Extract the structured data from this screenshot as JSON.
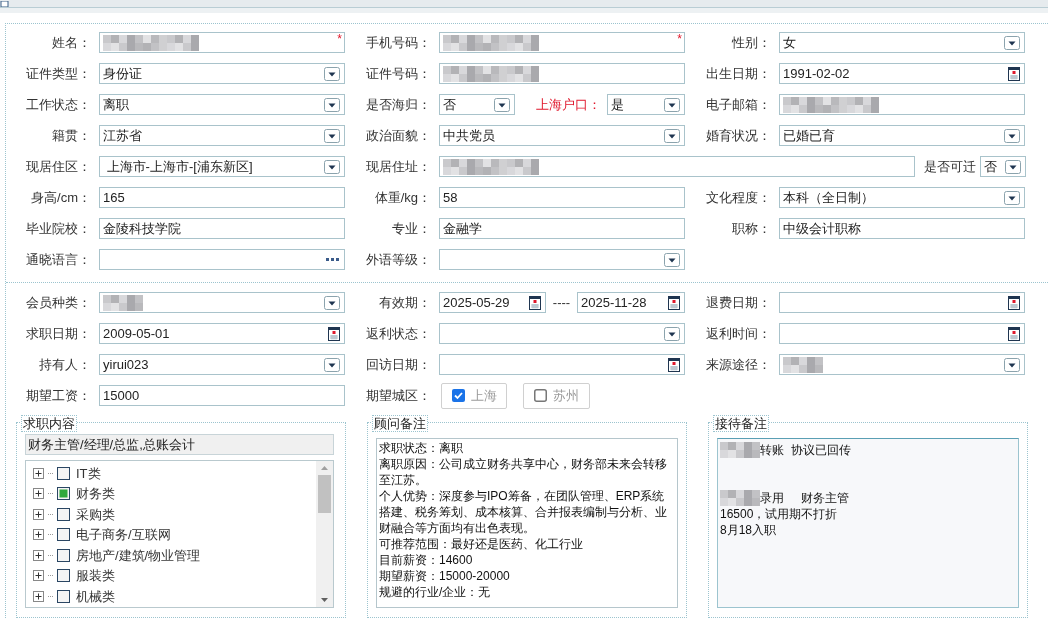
{
  "basic_rows": [
    {
      "cells": [
        {
          "label": "姓名：",
          "fields": [
            {
              "kind": "text",
              "redacted": true,
              "required_mark": "*"
            }
          ]
        },
        {
          "label": "手机号码：",
          "fields": [
            {
              "kind": "text",
              "redacted": true,
              "required_mark": "*"
            }
          ]
        },
        {
          "label": "性别：",
          "fields": [
            {
              "kind": "select",
              "value": "女"
            }
          ]
        }
      ]
    },
    {
      "cells": [
        {
          "label": "证件类型：",
          "fields": [
            {
              "kind": "select",
              "value": "身份证"
            }
          ]
        },
        {
          "label": "证件号码：",
          "fields": [
            {
              "kind": "text",
              "redacted": true
            }
          ]
        },
        {
          "label": "出生日期：",
          "fields": [
            {
              "kind": "date",
              "value": "1991-02-02"
            }
          ]
        }
      ]
    },
    {
      "cells": [
        {
          "label": "工作状态：",
          "fields": [
            {
              "kind": "select",
              "value": "离职"
            }
          ]
        },
        {
          "label": "是否海归：",
          "fields": [
            {
              "kind": "select",
              "value": "否"
            },
            {
              "kind": "select",
              "label": "上海户口：",
              "emphasized": true,
              "value": "是"
            }
          ]
        },
        {
          "label": "电子邮箱：",
          "fields": [
            {
              "kind": "text",
              "redacted": true
            }
          ]
        }
      ]
    },
    {
      "cells": [
        {
          "label": "籍贯：",
          "fields": [
            {
              "kind": "select",
              "value": "江苏省"
            }
          ]
        },
        {
          "label": "政治面貌：",
          "fields": [
            {
              "kind": "select",
              "value": "中共党员"
            }
          ]
        },
        {
          "label": "婚育状况：",
          "fields": [
            {
              "kind": "select",
              "value": "已婚已育"
            }
          ]
        }
      ]
    },
    {
      "cells": [
        {
          "label": "现居住区：",
          "fields": [
            {
              "kind": "select",
              "value": " 上海市-上海市-[浦东新区]"
            }
          ]
        },
        {
          "label": "现居住址：",
          "fields": [
            {
              "kind": "text",
              "redacted": true
            }
          ],
          "trailing": {
            "label": "是否可迁",
            "field": {
              "kind": "select",
              "value": "否"
            }
          }
        }
      ]
    },
    {
      "cells": [
        {
          "label": "身高/cm：",
          "fields": [
            {
              "kind": "text",
              "value": "165"
            }
          ]
        },
        {
          "label": "体重/kg：",
          "fields": [
            {
              "kind": "text",
              "value": "58"
            }
          ]
        },
        {
          "label": "文化程度：",
          "fields": [
            {
              "kind": "select",
              "value": "本科（全日制）"
            }
          ]
        }
      ]
    },
    {
      "cells": [
        {
          "label": "毕业院校：",
          "fields": [
            {
              "kind": "text",
              "value": "金陵科技学院"
            }
          ]
        },
        {
          "label": "专业：",
          "fields": [
            {
              "kind": "text",
              "value": "金融学"
            }
          ]
        },
        {
          "label": "职称：",
          "fields": [
            {
              "kind": "text",
              "value": "中级会计职称"
            }
          ]
        }
      ]
    },
    {
      "cells": [
        {
          "label": "通晓语言：",
          "fields": [
            {
              "kind": "lookup"
            }
          ]
        },
        {
          "label": "外语等级：",
          "fields": [
            {
              "kind": "select"
            }
          ]
        },
        null
      ]
    }
  ],
  "member_rows": [
    {
      "cells": [
        {
          "label": "会员种类：",
          "fields": [
            {
              "kind": "select",
              "redacted": true
            }
          ]
        },
        {
          "label": "有效期：",
          "fields": [
            {
              "kind": "date",
              "value": "2025-05-29"
            },
            {
              "kind": "date",
              "label": "----",
              "emphasized": false,
              "value": "2025-11-28"
            }
          ]
        },
        {
          "label": "退费日期：",
          "fields": [
            {
              "kind": "date"
            }
          ]
        }
      ]
    },
    {
      "cells": [
        {
          "label": "求职日期：",
          "fields": [
            {
              "kind": "date",
              "value": "2009-05-01"
            }
          ]
        },
        {
          "label": "返利状态：",
          "fields": [
            {
              "kind": "select"
            }
          ]
        },
        {
          "label": "返利时间：",
          "fields": [
            {
              "kind": "date"
            }
          ]
        }
      ]
    },
    {
      "cells": [
        {
          "label": "持有人：",
          "fields": [
            {
              "kind": "select",
              "value": "yirui023"
            }
          ]
        },
        {
          "label": "回访日期：",
          "fields": [
            {
              "kind": "date"
            }
          ]
        },
        {
          "label": "来源途径：",
          "fields": [
            {
              "kind": "select",
              "redacted": true
            }
          ]
        }
      ]
    },
    {
      "cells": [
        {
          "label": "期望工资：",
          "fields": [
            {
              "kind": "text",
              "value": "15000"
            }
          ]
        },
        {
          "label": "期望城区：",
          "fields": [
            {
              "kind": "checkbox",
              "label": "上海",
              "checked": true
            },
            {
              "kind": "checkbox",
              "label": "苏州",
              "checked": false
            }
          ]
        },
        null
      ]
    }
  ],
  "panels": [
    {
      "kind": "tree",
      "legend": "求职内容",
      "summary": "财务主管/经理/总监,总账会计",
      "items": [
        {
          "label": "IT类",
          "partial": false,
          "expanded": false
        },
        {
          "label": "财务类",
          "partial": true,
          "expanded": false
        },
        {
          "label": "采购类",
          "partial": false,
          "expanded": false
        },
        {
          "label": "电子商务/互联网",
          "partial": false,
          "expanded": false
        },
        {
          "label": "房地产/建筑/物业管理",
          "partial": false,
          "expanded": false
        },
        {
          "label": "服装类",
          "partial": false,
          "expanded": false
        },
        {
          "label": "机械类",
          "partial": false,
          "expanded": false
        }
      ]
    },
    {
      "kind": "notes",
      "legend": "顾问备注",
      "readonly": false,
      "paragraphs": [
        "求职状态：离职",
        "离职原因：公司成立财务共享中心，财务部未来会转移至江苏。",
        "个人优势：深度参与IPO筹备，在团队管理、ERP系统搭建、税务筹划、成本核算、合并报表编制与分析、业财融合等方面均有出色表现。",
        "可推荐范围：最好还是医药、化工行业",
        "目前薪资：14600",
        "期望薪资：15000-20000",
        "规避的行业/企业：无"
      ]
    },
    {
      "kind": "notes",
      "legend": "接待备注",
      "readonly": true,
      "lines": [
        {
          "text": "转账  协议已回传",
          "redacted": true,
          "gap_before": false
        },
        {
          "text": "录用     财务主管",
          "redacted": true,
          "gap_before": true
        },
        {
          "text": "16500，试用期不打折",
          "redacted": false,
          "gap_before": false
        },
        {
          "text": "8月18入职",
          "redacted": false,
          "gap_before": false
        }
      ]
    }
  ]
}
